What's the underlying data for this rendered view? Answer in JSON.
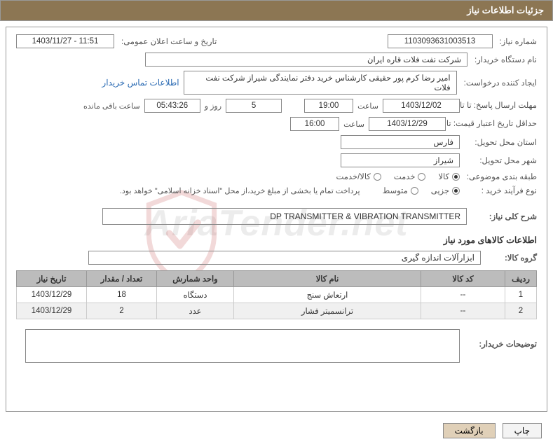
{
  "header": {
    "title": "جزئیات اطلاعات نیاز"
  },
  "fields": {
    "need_number_label": "شماره نیاز:",
    "need_number": "1103093631003513",
    "announce_label": "تاریخ و ساعت اعلان عمومی:",
    "announce_value": "1403/11/27 - 11:51",
    "buyer_org_label": "نام دستگاه خریدار:",
    "buyer_org": "شرکت نفت فلات قاره ایران",
    "requester_label": "ایجاد کننده درخواست:",
    "requester": "امیر رضا کرم پور حقیقی کارشناس خرید دفتر نمایندگی شیراز شرکت نفت فلات",
    "contact_link": "اطلاعات تماس خریدار",
    "reply_deadline_label": "مهلت ارسال پاسخ: تا تاریخ:",
    "reply_date": "1403/12/02",
    "time_label": "ساعت",
    "reply_time": "19:00",
    "days_field": "5",
    "days_and": "روز و",
    "countdown": "05:43:26",
    "remaining": "ساعت باقی مانده",
    "price_validity_label": "حداقل تاریخ اعتبار قیمت: تا تاریخ:",
    "price_validity_date": "1403/12/29",
    "price_validity_time": "16:00",
    "province_label": "استان محل تحویل:",
    "province": "فارس",
    "city_label": "شهر محل تحویل:",
    "city": "شیراز",
    "subject_class_label": "طبقه بندی موضوعی:",
    "radio_goods": "کالا",
    "radio_service": "خدمت",
    "radio_goods_service": "کالا/خدمت",
    "process_type_label": "نوع فرآیند خرید :",
    "radio_partial": "جزیی",
    "radio_medium": "متوسط",
    "payment_note": "پرداخت تمام یا بخشی از مبلغ خرید،از محل \"اسناد خزانه اسلامی\" خواهد بود.",
    "general_desc_label": "شرح کلی نیاز:",
    "general_desc": "DP TRANSMITTER & VIBRATION TRANSMITTER",
    "goods_info_title": "اطلاعات کالاهای مورد نیاز",
    "goods_group_label": "گروه کالا:",
    "goods_group": "ابزارآلات اندازه گیری",
    "buyer_notes_label": "توضیحات خریدار:"
  },
  "table": {
    "headers": {
      "row": "ردیف",
      "code": "کد کالا",
      "name": "نام کالا",
      "unit": "واحد شمارش",
      "qty": "تعداد / مقدار",
      "date": "تاریخ نیاز"
    },
    "rows": [
      {
        "row": "1",
        "code": "--",
        "name": "ارتعاش سنج",
        "unit": "دستگاه",
        "qty": "18",
        "date": "1403/12/29"
      },
      {
        "row": "2",
        "code": "--",
        "name": "ترانسمیتر فشار",
        "unit": "عدد",
        "qty": "2",
        "date": "1403/12/29"
      }
    ]
  },
  "buttons": {
    "print": "چاپ",
    "back": "بازگشت"
  },
  "watermark": "AriaTender.net"
}
